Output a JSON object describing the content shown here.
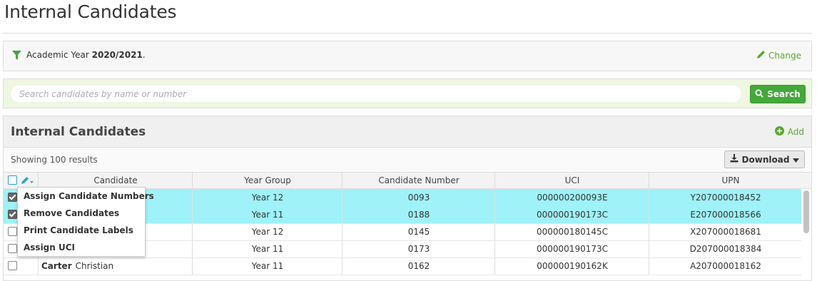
{
  "page": {
    "title": "Internal Candidates"
  },
  "filter": {
    "label": "Academic Year",
    "value": "2020/2021",
    "suffix": ".",
    "change_label": "Change"
  },
  "search": {
    "placeholder": "Search candidates by name or number",
    "button_label": "Search"
  },
  "panel": {
    "title": "Internal Candidates",
    "add_label": "Add",
    "showing": "Showing 100 results",
    "download_label": "Download"
  },
  "table": {
    "columns": [
      "Candidate",
      "Year Group",
      "Candidate Number",
      "UCI",
      "UPN"
    ],
    "rows": [
      {
        "checked": true,
        "selected": true,
        "surname": "",
        "forename": "",
        "year_group": "Year 12",
        "number": "0093",
        "uci": "000000200093E",
        "upn": "Y207000018452"
      },
      {
        "checked": true,
        "selected": true,
        "surname": "",
        "forename": "",
        "year_group": "Year 11",
        "number": "0188",
        "uci": "000000190173C",
        "upn": "E207000018566"
      },
      {
        "checked": false,
        "selected": false,
        "surname": "",
        "forename": "",
        "year_group": "Year 12",
        "number": "0145",
        "uci": "000000180145C",
        "upn": "X207000018681"
      },
      {
        "checked": false,
        "selected": false,
        "surname": "",
        "forename": "",
        "year_group": "Year 11",
        "number": "0173",
        "uci": "000000190173C",
        "upn": "D207000018384"
      },
      {
        "checked": false,
        "selected": false,
        "surname": "Carter",
        "forename": "Christian",
        "year_group": "Year 11",
        "number": "0162",
        "uci": "000000190162K",
        "upn": "A207000018162"
      }
    ]
  },
  "bulk_menu": {
    "items": [
      "Assign Candidate Numbers",
      "Remove Candidates",
      "Print Candidate Labels",
      "Assign UCI"
    ]
  },
  "colors": {
    "accent_green": "#44a83a",
    "link_green": "#5aa82a",
    "selected_row": "#9ef2f8"
  }
}
